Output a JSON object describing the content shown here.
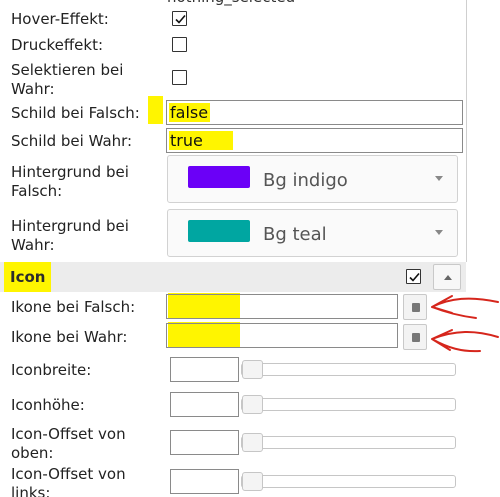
{
  "header": {
    "cut_text": "nothing_selected"
  },
  "rows": {
    "hover": {
      "label": "Hover-Effekt:",
      "checked": true
    },
    "press": {
      "label": "Druckeffekt:",
      "checked": false
    },
    "select_when_true": {
      "label_line1": "Selektieren bei",
      "label_line2": "Wahr:",
      "checked": false
    },
    "shield_false": {
      "label": "Schild bei Falsch:",
      "value": "false"
    },
    "shield_true": {
      "label": "Schild bei Wahr:",
      "value": "true"
    },
    "bg_false": {
      "label_line1": "Hintergrund bei",
      "label_line2": "Falsch:",
      "value": "Bg indigo",
      "swatch_color": "#6b00f7"
    },
    "bg_true": {
      "label_line1": "Hintergrund bei",
      "label_line2": "Wahr:",
      "value": "Bg teal",
      "swatch_color": "#00a6a1"
    }
  },
  "icon_section": {
    "title": "Icon",
    "enabled": true,
    "icon_false": {
      "label": "Ikone bei Falsch:",
      "value": ""
    },
    "icon_true": {
      "label": "Ikone bei Wahr:",
      "value": ""
    },
    "icon_width": {
      "label": "Iconbreite:",
      "value": ""
    },
    "icon_height": {
      "label": "Iconhöhe:",
      "value": ""
    },
    "icon_offset_top": {
      "label_line1": "Icon-Offset von",
      "label_line2": "oben:",
      "value": ""
    },
    "icon_offset_left": {
      "label_line1": "Icon-Offset von",
      "label_line2": "links:",
      "value": ""
    }
  },
  "colors": {
    "highlight": "#fff500",
    "annotation": "#d6261c"
  }
}
